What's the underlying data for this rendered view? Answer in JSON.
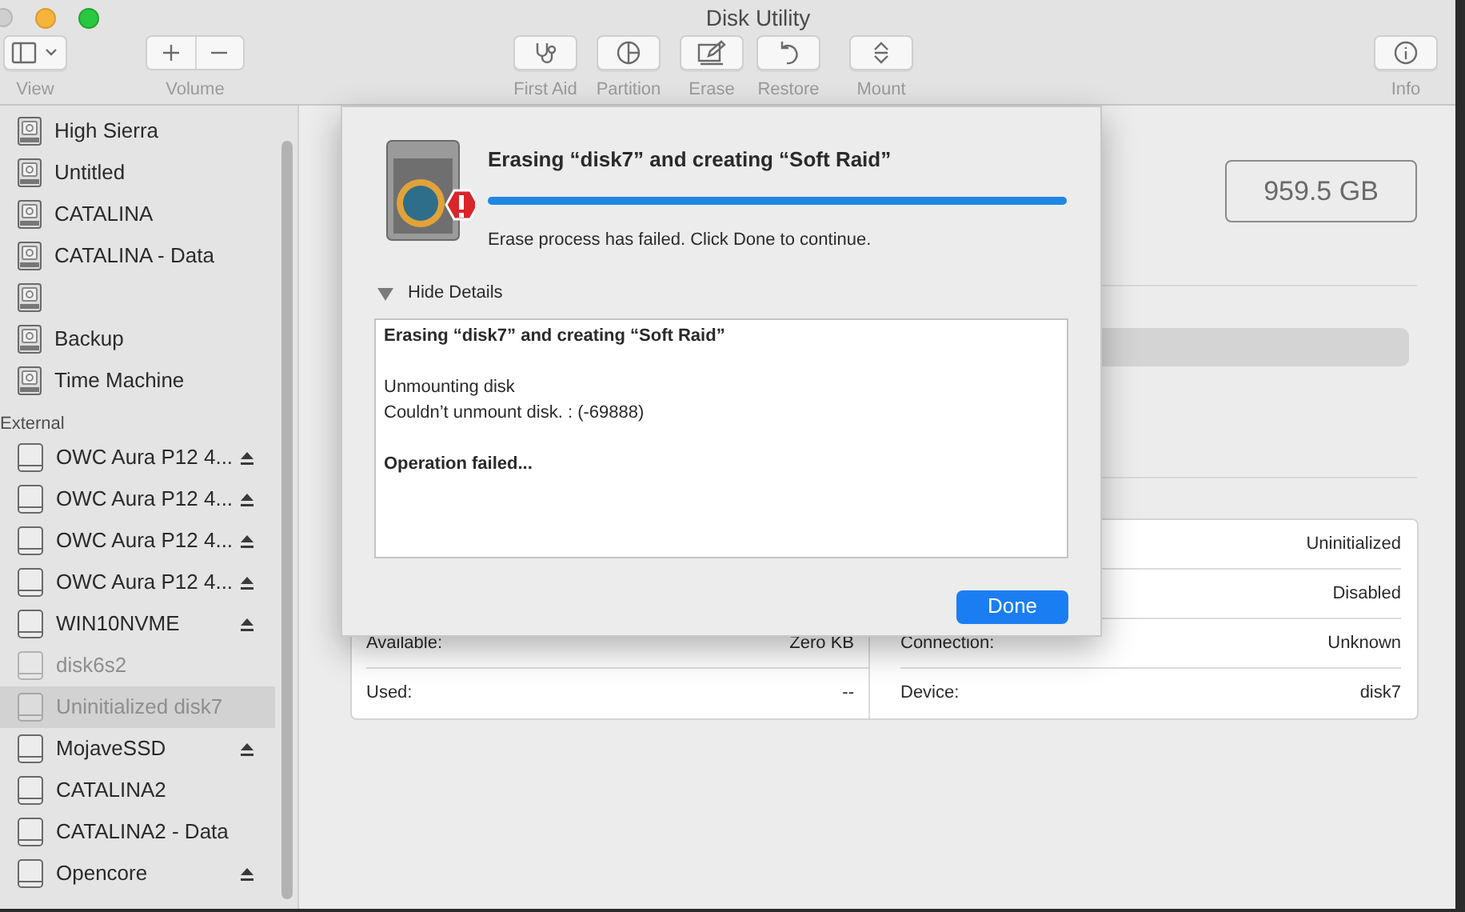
{
  "window": {
    "title": "Disk Utility"
  },
  "toolbar": [
    {
      "kind": "view",
      "label": "View"
    },
    {
      "kind": "volume",
      "label": "Volume"
    },
    {
      "kind": "first_aid",
      "label": "First Aid"
    },
    {
      "kind": "partition",
      "label": "Partition"
    },
    {
      "kind": "erase",
      "label": "Erase"
    },
    {
      "kind": "restore",
      "label": "Restore"
    },
    {
      "kind": "mount",
      "label": "Mount"
    },
    {
      "kind": "info",
      "label": "Info"
    }
  ],
  "sidebar": {
    "groups": [
      {
        "items": [
          {
            "label": "High Sierra",
            "kind": "internal",
            "eject": false,
            "disabled": false,
            "selected": false
          },
          {
            "label": "Untitled",
            "kind": "internal",
            "eject": false,
            "disabled": false,
            "selected": false
          },
          {
            "label": "CATALINA",
            "kind": "internal",
            "eject": false,
            "disabled": false,
            "selected": false
          },
          {
            "label": "CATALINA - Data",
            "kind": "internal",
            "eject": false,
            "disabled": false,
            "selected": false
          },
          {
            "kind": "internal",
            "eject": false,
            "disabled": false,
            "selected": false
          },
          {
            "label": "Backup",
            "kind": "internal",
            "eject": false,
            "disabled": false,
            "selected": false
          },
          {
            "label": "Time Machine",
            "kind": "internal",
            "eject": false,
            "disabled": false,
            "selected": false
          }
        ]
      },
      {
        "heading": "External",
        "items": [
          {
            "label": "OWC Aura P12 4...",
            "kind": "external",
            "eject": true,
            "disabled": false,
            "selected": false
          },
          {
            "label": "OWC Aura P12 4...",
            "kind": "external",
            "eject": true,
            "disabled": false,
            "selected": false
          },
          {
            "label": "OWC Aura P12 4...",
            "kind": "external",
            "eject": true,
            "disabled": false,
            "selected": false
          },
          {
            "label": "OWC Aura P12 4...",
            "kind": "external",
            "eject": true,
            "disabled": false,
            "selected": false
          },
          {
            "label": "WIN10NVME",
            "kind": "external",
            "eject": true,
            "disabled": false,
            "selected": false
          },
          {
            "label": "disk6s2",
            "kind": "external",
            "eject": false,
            "disabled": true,
            "selected": false
          },
          {
            "label": "Uninitialized disk7",
            "kind": "external",
            "eject": false,
            "disabled": true,
            "selected": true
          },
          {
            "label": "MojaveSSD",
            "kind": "external",
            "eject": true,
            "disabled": false,
            "selected": false
          },
          {
            "label": "CATALINA2",
            "kind": "external",
            "eject": false,
            "disabled": false,
            "selected": false
          },
          {
            "label": "CATALINA2 - Data",
            "kind": "external",
            "eject": false,
            "disabled": false,
            "selected": false
          },
          {
            "label": "Opencore",
            "kind": "external",
            "eject": true,
            "disabled": false,
            "selected": false
          }
        ]
      }
    ]
  },
  "main": {
    "capacity": "959.5 GB",
    "info_table": [
      {
        "right_value": "Uninitialized"
      },
      {
        "right_value": "Disabled"
      },
      {
        "left_label": "Available:",
        "left_value": "Zero KB",
        "right_label": "Connection:",
        "right_value": "Unknown"
      },
      {
        "left_label": "Used:",
        "left_value": "--",
        "right_label": "Device:",
        "right_value": "disk7"
      }
    ]
  },
  "dialog": {
    "title": "Erasing “disk7” and creating “Soft Raid”",
    "level": 1,
    "message": "Erase process has failed. Click Done to continue.",
    "details_toggle": "Hide Details",
    "expanded": true,
    "log": [
      [
        {
          "text": "Erasing “disk7” and creating “Soft Raid”",
          "bold": true
        }
      ],
      [
        {
          "text": "Unmounting disk",
          "bold": false
        },
        {
          "text": "Couldn’t unmount disk. : (-69888)",
          "bold": false
        }
      ],
      [
        {
          "text": "Operation failed...",
          "bold": true
        }
      ]
    ],
    "button": "Done"
  }
}
